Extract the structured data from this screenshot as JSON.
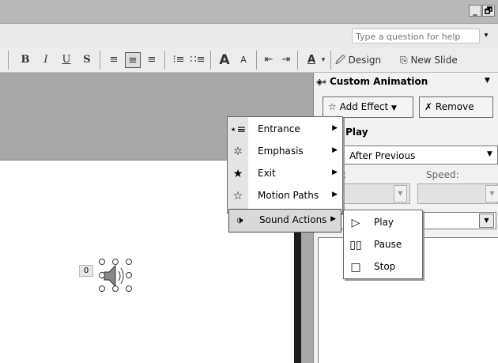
{
  "window": {
    "buttons": [
      "_",
      "🗗"
    ]
  },
  "help": {
    "placeholder": "Type a question for help",
    "drop": "▾"
  },
  "toolbar": {
    "bold": "B",
    "italic": "I",
    "underline": "U",
    "shadow": "S",
    "grow_font": "A",
    "shrink_font": "A",
    "font_color": "A",
    "design_label": "Design",
    "new_slide_label": "New Slide"
  },
  "pane": {
    "title": "Custom Animation",
    "add_effect_label": "Add Effect",
    "remove_label": "Remove",
    "modify_label": "ify: Play",
    "start_prefix": ":",
    "start_value": "After Previous",
    "property_label": "erty:",
    "speed_label": "Speed:"
  },
  "menu": {
    "items": [
      {
        "label": "Entrance",
        "icon": "entrance-star-icon"
      },
      {
        "label": "Emphasis",
        "icon": "emphasis-star-icon"
      },
      {
        "label": "Exit",
        "icon": "exit-star-icon"
      },
      {
        "label": "Motion Paths",
        "icon": "motion-path-star-icon"
      },
      {
        "label": "Sound Actions",
        "icon": "speaker-icon"
      }
    ]
  },
  "submenu": {
    "items": [
      {
        "label": "Play",
        "icon": "play-icon"
      },
      {
        "label": "Pause",
        "icon": "pause-icon"
      },
      {
        "label": "Stop",
        "icon": "stop-icon"
      }
    ]
  },
  "slide": {
    "sound_tag": "0"
  }
}
